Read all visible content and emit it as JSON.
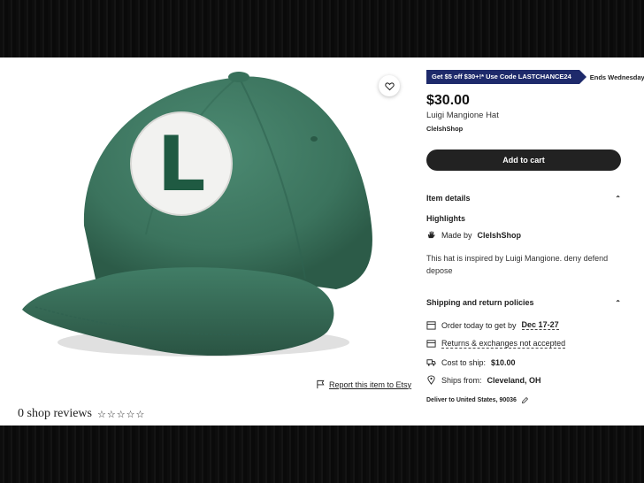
{
  "promo": {
    "banner": "Get $5 off $30+!* Use Code LASTCHANCE24",
    "ends": "Ends Wednesday!"
  },
  "product": {
    "price": "$30.00",
    "title": "Luigi Mangione Hat",
    "shop": "ClelshShop",
    "hat_letter": "L",
    "hat_color": "#3f7a63"
  },
  "cart": {
    "label": "Add to cart"
  },
  "item_details": {
    "heading": "Item details",
    "highlights": "Highlights",
    "made_by_prefix": "Made by",
    "made_by_shop": "ClelshShop",
    "description": "This hat is inspired by Luigi Mangione. deny defend depose"
  },
  "shipping": {
    "heading": "Shipping and return policies",
    "order_prefix": "Order today to get by",
    "order_date": "Dec 17-27",
    "returns": "Returns & exchanges not accepted",
    "cost_prefix": "Cost to ship:",
    "cost": "$10.00",
    "ships_prefix": "Ships from:",
    "ships_from": "Cleveland, OH",
    "deliver": "Deliver to United States, 90036"
  },
  "report": {
    "label": "Report this item to Etsy"
  },
  "reviews": {
    "label": "0 shop reviews",
    "rating": 0
  },
  "colors": {
    "accent_dark": "#222222",
    "promo_bg": "#1e2a6b"
  }
}
